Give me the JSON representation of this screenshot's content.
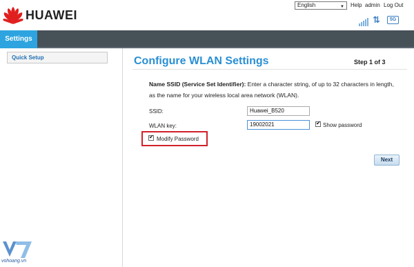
{
  "brand": {
    "logo_text": "HUAWEI",
    "logo_color": "#e0201f"
  },
  "header": {
    "language": "English",
    "links": {
      "help": "Help",
      "admin": "admin",
      "logout": "Log Out"
    },
    "status": {
      "updown_glyph": "⇅",
      "badge": "5G"
    }
  },
  "nav": {
    "active_tab": "Settings",
    "bar_color": "#475158",
    "active_color": "#2da4e0"
  },
  "sidebar": {
    "items": [
      {
        "label": "Quick Setup"
      }
    ]
  },
  "main": {
    "title": "Configure WLAN Settings",
    "step": "Step 1 of 3",
    "description_bold": "Name SSID (Service Set Identifier):",
    "description_rest": " Enter a character string, of up to 32 characters in length, as the name for your wireless local area network (WLAN).",
    "form": {
      "ssid_label": "SSID:",
      "ssid_value": "Huawei_B520",
      "key_label": "WLAN key:",
      "key_value": "19002021",
      "show_password_label": "Show password",
      "show_password_checked": true,
      "modify_password_label": "Modify Password",
      "modify_password_checked": true
    },
    "next_label": "Next"
  },
  "watermark": {
    "text": "vohoang.vn"
  }
}
